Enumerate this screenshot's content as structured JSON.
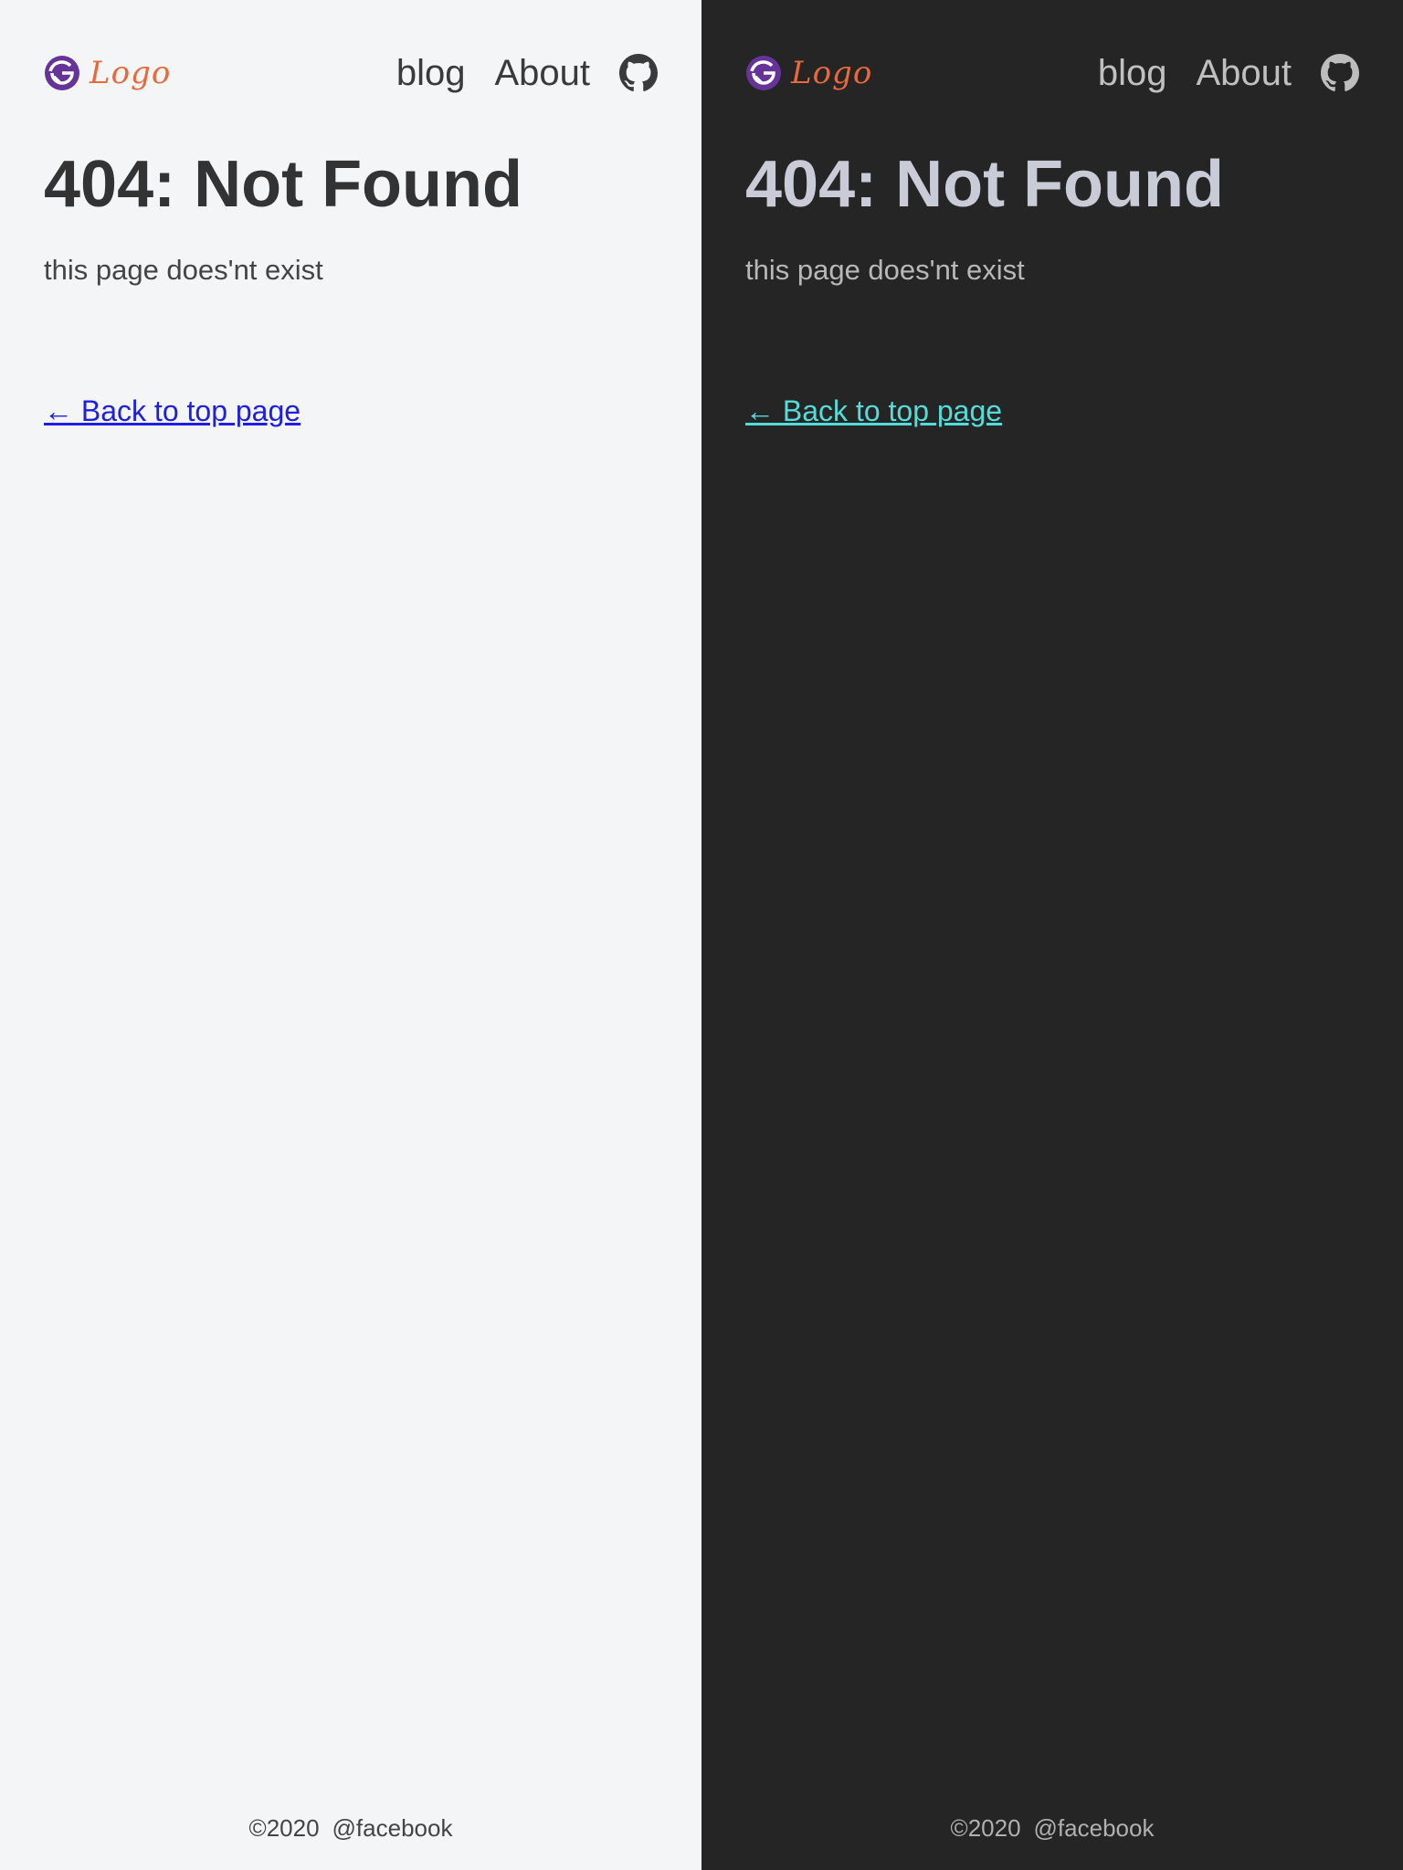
{
  "colors": {
    "light_bg": "#f4f5f7",
    "dark_bg": "#252525",
    "brand_purple": "#663399",
    "logo_text": "#e8693a",
    "light_link": "#1f1fe0",
    "dark_link": "#55dcd8"
  },
  "light": {
    "header": {
      "logo_icon": "gatsby-logo-icon",
      "logo_text": "Logo",
      "nav": {
        "blog": "blog",
        "about": "About"
      },
      "github_icon": "github-icon"
    },
    "main": {
      "title": "404: Not Found",
      "subtitle": "this page does'nt exist",
      "back_link": "← Back to top page"
    },
    "footer": {
      "copyright": "©2020",
      "social": "@facebook"
    }
  },
  "dark": {
    "header": {
      "logo_icon": "gatsby-logo-icon",
      "logo_text": "Logo",
      "nav": {
        "blog": "blog",
        "about": "About"
      },
      "github_icon": "github-icon"
    },
    "main": {
      "title": "404: Not Found",
      "subtitle": "this page does'nt exist",
      "back_link": "← Back to top page"
    },
    "footer": {
      "copyright": "©2020",
      "social": "@facebook"
    }
  }
}
